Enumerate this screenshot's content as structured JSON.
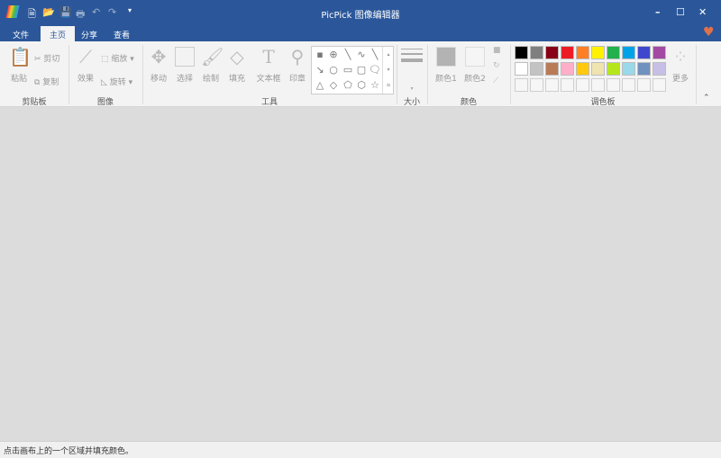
{
  "window": {
    "title": "PicPick 图像编辑器",
    "minimize": "–",
    "maximize": "☐",
    "close": "✕"
  },
  "quick_access": [
    "🗎",
    "📂",
    "💾",
    "🖶",
    "↶",
    "↷",
    "▾"
  ],
  "tabs": [
    {
      "label": "文件"
    },
    {
      "label": "主页"
    },
    {
      "label": "分享"
    },
    {
      "label": "查看"
    }
  ],
  "heart": "♥",
  "groups": {
    "clipboard": "剪贴板",
    "image": "图像",
    "tools": "工具",
    "size": "大小",
    "color": "颜色",
    "palette": "调色板"
  },
  "clipboard": {
    "paste": "粘贴",
    "cut": "剪切",
    "copy": "复制"
  },
  "image": {
    "effects": "效果",
    "resize": "缩放",
    "rotate": "旋转"
  },
  "tools": {
    "move": "移动",
    "select": "选择",
    "draw": "绘制",
    "fill": "填充",
    "textbox": "文本框",
    "stamp": "印章"
  },
  "shapes": [
    "▪",
    "⊕",
    "╲",
    "∿",
    "╲",
    "↘",
    "○",
    "▭",
    "▢",
    "🗨",
    "△",
    "◇",
    "⬠",
    "⬡",
    "☆"
  ],
  "colors": {
    "color1": "颜色1",
    "color2": "颜色2",
    "color1_value": "#b3b3b3",
    "color2_value": "#f5f5f5"
  },
  "palette_more": "更多",
  "palette_row1": [
    "#000000",
    "#7f7f7f",
    "#880015",
    "#ed1c24",
    "#ff7f27",
    "#fff200",
    "#22b14c",
    "#00a2e8",
    "#3f48cc",
    "#a349a4"
  ],
  "palette_row2": [
    "#ffffff",
    "#c3c3c3",
    "#b97a57",
    "#ffaec9",
    "#ffc90e",
    "#efe4b0",
    "#b5e61d",
    "#99d9ea",
    "#7092be",
    "#c8bfe7"
  ],
  "status": "点击画布上的一个区域并填充颜色。"
}
